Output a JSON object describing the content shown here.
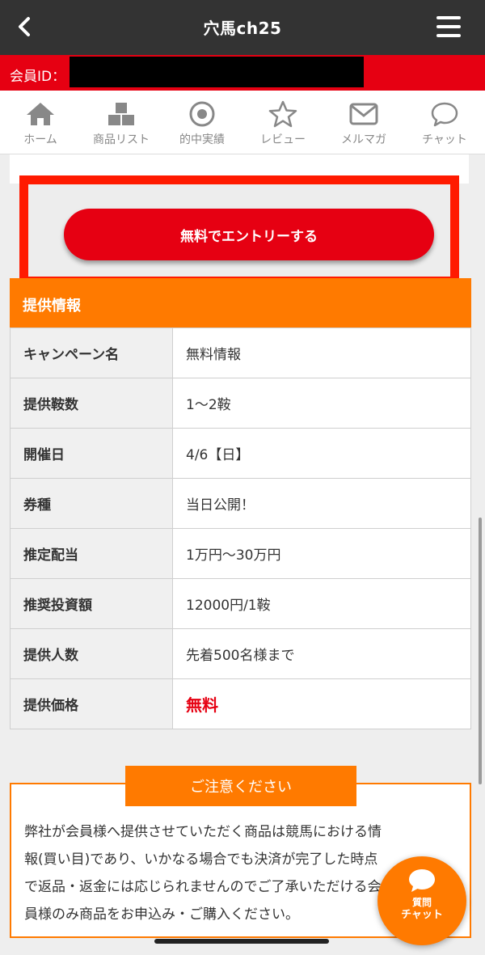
{
  "header": {
    "title": "穴馬ch25"
  },
  "member": {
    "label": "会員ID："
  },
  "nav": [
    {
      "label": "ホーム",
      "icon": "home-icon"
    },
    {
      "label": "商品リスト",
      "icon": "boxes-icon"
    },
    {
      "label": "的中実績",
      "icon": "target-icon"
    },
    {
      "label": "レビュー",
      "icon": "star-icon"
    },
    {
      "label": "メルマガ",
      "icon": "mail-icon"
    },
    {
      "label": "チャット",
      "icon": "chat-icon"
    }
  ],
  "entry": {
    "label": "無料でエントリーする"
  },
  "info": {
    "title": "提供情報",
    "rows": [
      {
        "key": "キャンペーン名",
        "value": "無料情報"
      },
      {
        "key": "提供鞍数",
        "value": "1〜2鞍"
      },
      {
        "key": "開催日",
        "value": "4/6【日】"
      },
      {
        "key": "券種",
        "value": "当日公開！"
      },
      {
        "key": "推定配当",
        "value": "1万円〜30万円"
      },
      {
        "key": "推奨投資額",
        "value": "12000円/1鞍"
      },
      {
        "key": "提供人数",
        "value": "先着500名様まで"
      },
      {
        "key": "提供価格",
        "value": "無料"
      }
    ]
  },
  "notice": {
    "title": "ご注意ください",
    "lines": [
      "弊社が会員様へ提供させていただく商品は競馬における情",
      "報(買い目)であり、いかなる場合でも決済が完了した時点",
      "で返品・返金には応じられませんのでご了承いただける会",
      "員様のみ商品をお申込み・ご購入ください。"
    ]
  },
  "chat_fab": {
    "line1": "質問",
    "line2": "チャット"
  },
  "colors": {
    "red": "#e60012",
    "orange": "#ff7a00",
    "dark": "#333333"
  }
}
